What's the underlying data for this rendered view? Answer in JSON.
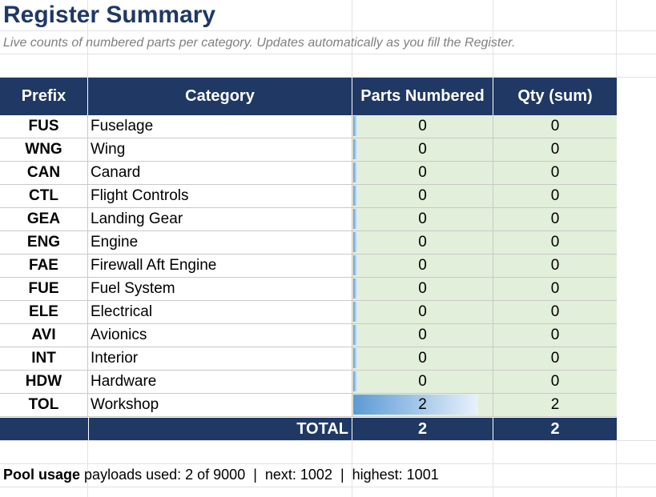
{
  "sheet": {
    "title": "Register Summary",
    "subtitle": "Live counts of numbered parts per category. Updates automatically as you fill the Register."
  },
  "table": {
    "headers": {
      "prefix": "Prefix",
      "category": "Category",
      "parts": "Parts Numbered",
      "qty": "Qty (sum)"
    },
    "rows": [
      {
        "prefix": "FUS",
        "category": "Fuselage",
        "parts": "0",
        "qty": "0",
        "bar_fraction": 0
      },
      {
        "prefix": "WNG",
        "category": "Wing",
        "parts": "0",
        "qty": "0",
        "bar_fraction": 0
      },
      {
        "prefix": "CAN",
        "category": "Canard",
        "parts": "0",
        "qty": "0",
        "bar_fraction": 0
      },
      {
        "prefix": "CTL",
        "category": "Flight Controls",
        "parts": "0",
        "qty": "0",
        "bar_fraction": 0
      },
      {
        "prefix": "GEA",
        "category": "Landing Gear",
        "parts": "0",
        "qty": "0",
        "bar_fraction": 0
      },
      {
        "prefix": "ENG",
        "category": "Engine",
        "parts": "0",
        "qty": "0",
        "bar_fraction": 0
      },
      {
        "prefix": "FAE",
        "category": "Firewall Aft Engine",
        "parts": "0",
        "qty": "0",
        "bar_fraction": 0
      },
      {
        "prefix": "FUE",
        "category": "Fuel System",
        "parts": "0",
        "qty": "0",
        "bar_fraction": 0
      },
      {
        "prefix": "ELE",
        "category": "Electrical",
        "parts": "0",
        "qty": "0",
        "bar_fraction": 0
      },
      {
        "prefix": "AVI",
        "category": "Avionics",
        "parts": "0",
        "qty": "0",
        "bar_fraction": 0
      },
      {
        "prefix": "INT",
        "category": "Interior",
        "parts": "0",
        "qty": "0",
        "bar_fraction": 0
      },
      {
        "prefix": "HDW",
        "category": "Hardware",
        "parts": "0",
        "qty": "0",
        "bar_fraction": 0
      },
      {
        "prefix": "TOL",
        "category": "Workshop",
        "parts": "2",
        "qty": "2",
        "bar_fraction": 1
      }
    ],
    "total": {
      "label": "TOTAL",
      "parts": "2",
      "qty": "2"
    }
  },
  "pool": {
    "label": "Pool usage",
    "text": "payloads used: 2 of 9000  |  next: 1002  |  highest: 1001"
  },
  "colors": {
    "header_bg": "#1f3864",
    "value_bg": "#e2efda",
    "databar": "#5b9bd5",
    "title": "#1f3864"
  }
}
